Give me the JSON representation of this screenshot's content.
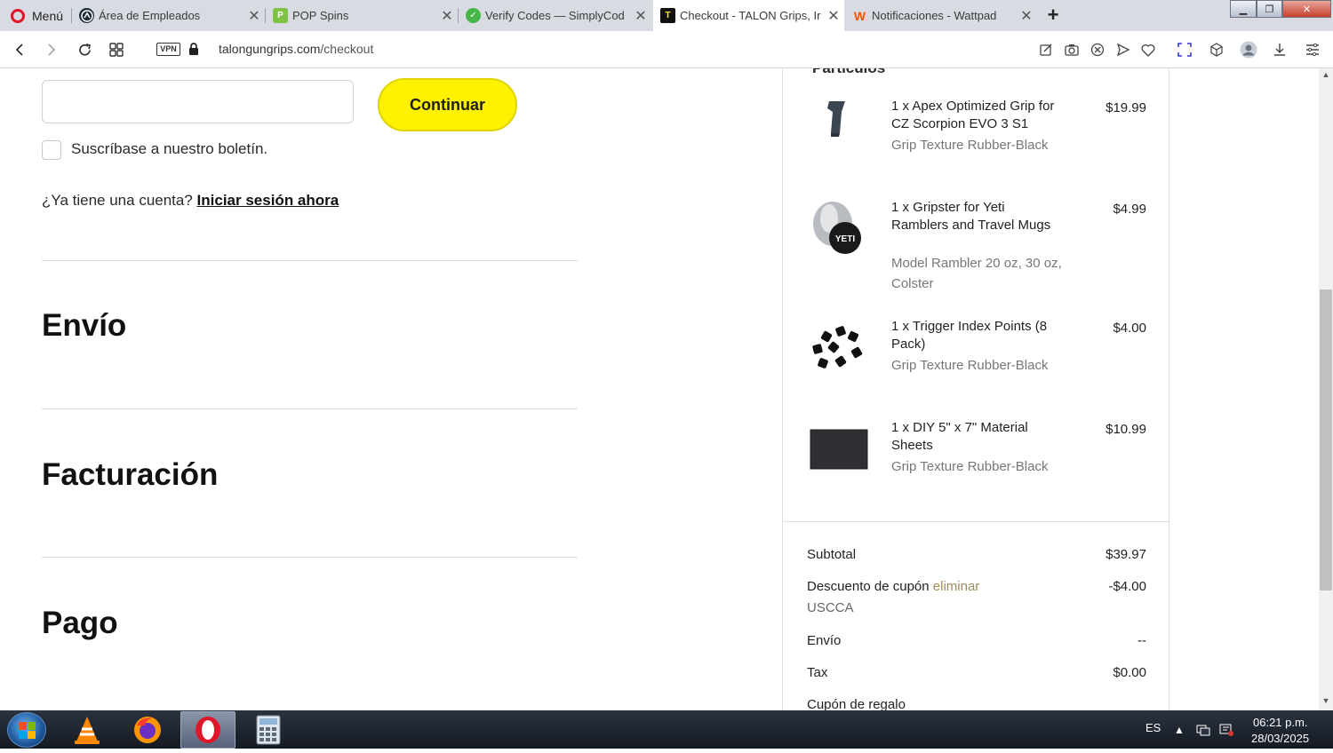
{
  "browser": {
    "menu_label": "Menú",
    "tabs": [
      {
        "label": "Área de Empleados",
        "icon": "edge-logo-icon"
      },
      {
        "label": "POP Spins",
        "icon": "pop-spins-logo-icon"
      },
      {
        "label": "Verify Codes — SimplyCod",
        "icon": "simplycodes-logo-icon"
      },
      {
        "label": "Checkout - TALON Grips, Ir",
        "icon": "talon-logo-icon",
        "active": true
      },
      {
        "label": "Notificaciones - Wattpad",
        "icon": "wattpad-logo-icon"
      }
    ],
    "url_host": "talongungrips.com",
    "url_path": "/checkout",
    "vpn_label": "VPN"
  },
  "form": {
    "continue_label": "Continuar",
    "newsletter_label": "Suscríbase a nuestro boletín.",
    "account_question": "¿Ya tiene una cuenta?",
    "login_link": "Iniciar sesión ahora"
  },
  "sections": {
    "shipping": "Envío",
    "billing": "Facturación",
    "payment": "Pago"
  },
  "summary": {
    "title": "Partículos",
    "items": [
      {
        "name": "1 x Apex Optimized Grip for CZ Scorpion EVO 3 S1",
        "variant": "Grip Texture Rubber-Black",
        "price": "$19.99"
      },
      {
        "name": "1 x Gripster for Yeti Ramblers and Travel Mugs",
        "variant": "Model Rambler 20 oz, 30 oz, Colster",
        "price": "$4.99"
      },
      {
        "name": "1 x Trigger Index Points (8 Pack)",
        "variant": "Grip Texture Rubber-Black",
        "price": "$4.00"
      },
      {
        "name": "1 x DIY 5\" x 7\" Material Sheets",
        "variant": "Grip Texture Rubber-Black",
        "price": "$10.99"
      }
    ],
    "subtotal_label": "Subtotal",
    "subtotal_value": "$39.97",
    "coupon_label": "Descuento de cupón",
    "coupon_remove": "eliminar",
    "coupon_code": "USCCA",
    "coupon_value": "-$4.00",
    "shipping_label": "Envío",
    "shipping_value": "--",
    "tax_label": "Tax",
    "tax_value": "$0.00",
    "gift_label": "Cupón de regalo"
  },
  "taskbar": {
    "language": "ES",
    "time": "06:21 p.m.",
    "date": "28/03/2025"
  },
  "colors": {
    "continue_button": "#fff200",
    "coupon_remove": "#a18c5a",
    "tabbar": "#d9dbe3"
  }
}
